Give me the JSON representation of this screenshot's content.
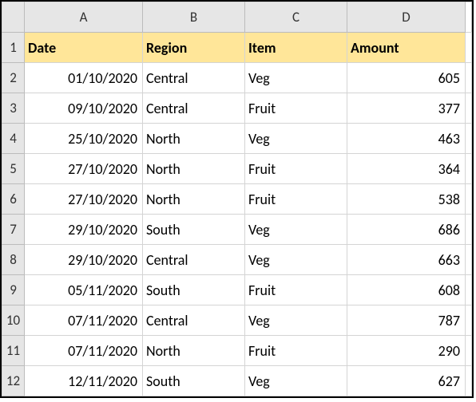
{
  "columns": [
    "A",
    "B",
    "C",
    "D"
  ],
  "row_numbers": [
    1,
    2,
    3,
    4,
    5,
    6,
    7,
    8,
    9,
    10,
    11,
    12
  ],
  "headers": {
    "date": "Date",
    "region": "Region",
    "item": "Item",
    "amount": "Amount"
  },
  "rows": [
    {
      "date": "01/10/2020",
      "region": "Central",
      "item": "Veg",
      "amount": "605"
    },
    {
      "date": "09/10/2020",
      "region": "Central",
      "item": "Fruit",
      "amount": "377"
    },
    {
      "date": "25/10/2020",
      "region": "North",
      "item": "Veg",
      "amount": "463"
    },
    {
      "date": "27/10/2020",
      "region": "North",
      "item": "Fruit",
      "amount": "364"
    },
    {
      "date": "27/10/2020",
      "region": "North",
      "item": "Fruit",
      "amount": "538"
    },
    {
      "date": "29/10/2020",
      "region": "South",
      "item": "Veg",
      "amount": "686"
    },
    {
      "date": "29/10/2020",
      "region": "Central",
      "item": "Veg",
      "amount": "663"
    },
    {
      "date": "05/11/2020",
      "region": "South",
      "item": "Fruit",
      "amount": "608"
    },
    {
      "date": "07/11/2020",
      "region": "Central",
      "item": "Veg",
      "amount": "787"
    },
    {
      "date": "07/11/2020",
      "region": "North",
      "item": "Fruit",
      "amount": "290"
    },
    {
      "date": "12/11/2020",
      "region": "South",
      "item": "Veg",
      "amount": "627"
    }
  ]
}
